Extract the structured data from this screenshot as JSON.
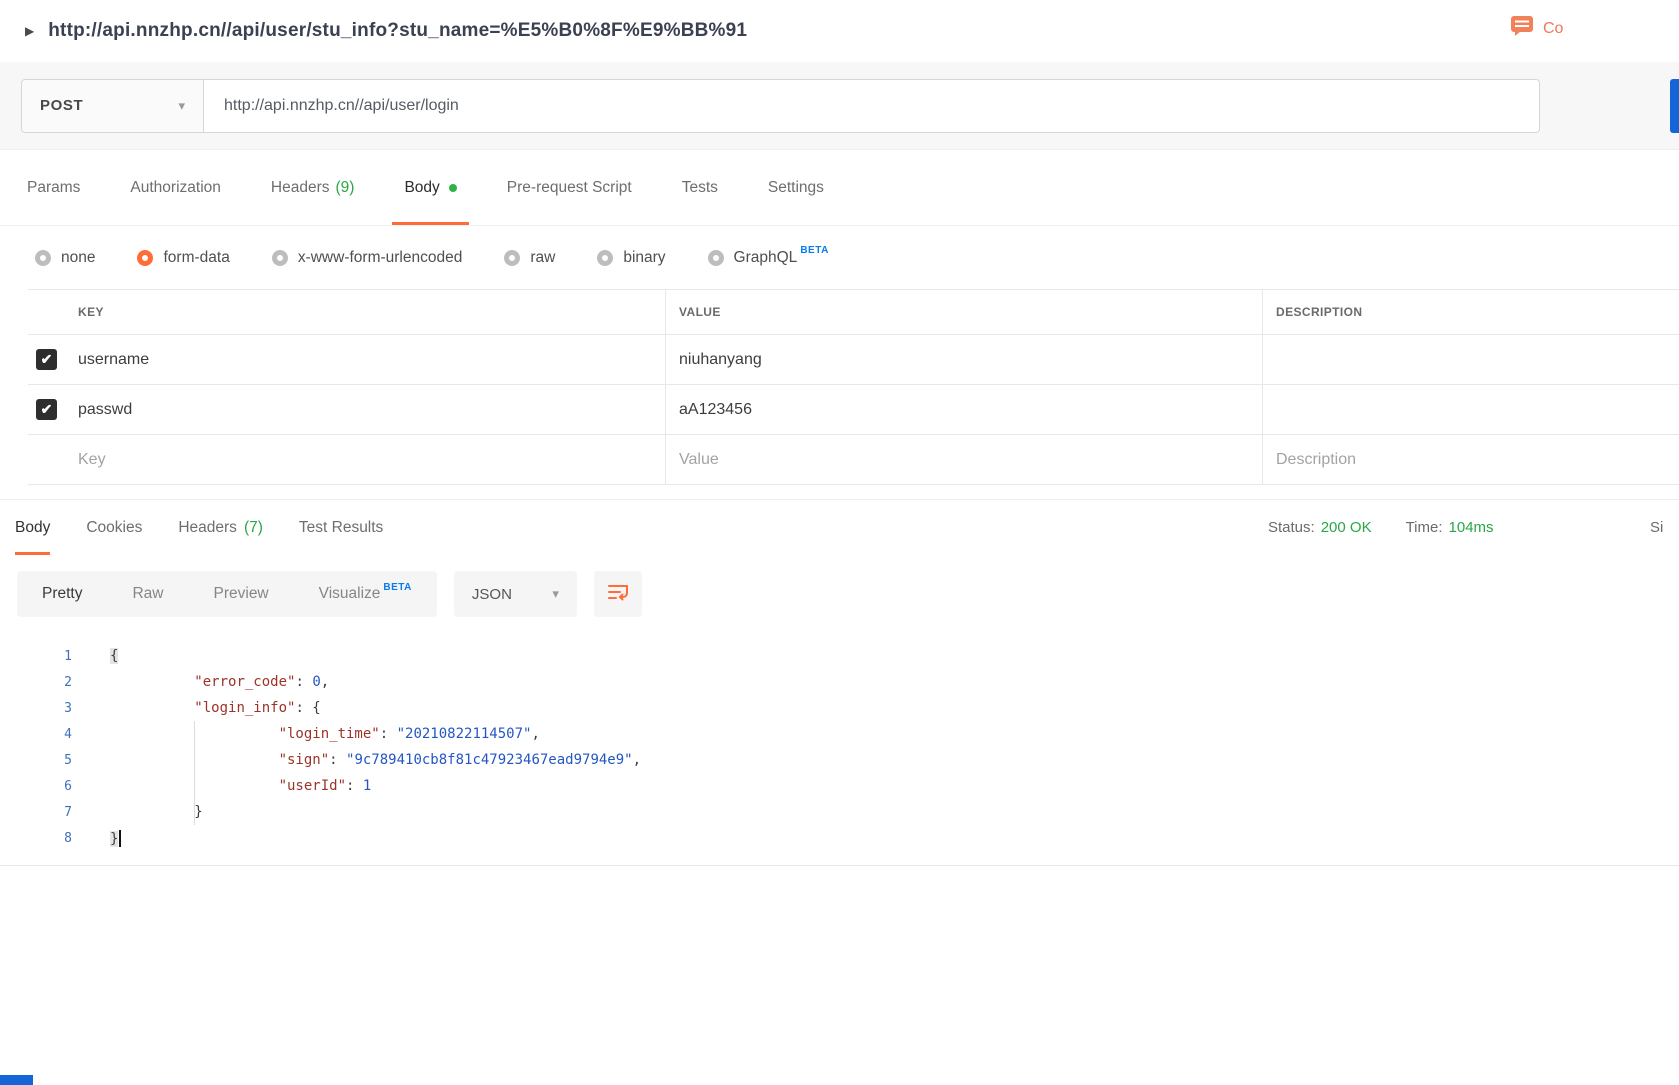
{
  "titlebar": {
    "request_url": "http://api.nnzhp.cn//api/user/stu_info?stu_name=%E5%B0%8F%E9%BB%91",
    "comments_label": "Co"
  },
  "request": {
    "method": "POST",
    "url": "http://api.nnzhp.cn//api/user/login"
  },
  "request_tabs": [
    {
      "label": "Params"
    },
    {
      "label": "Authorization"
    },
    {
      "label": "Headers",
      "count": "(9)"
    },
    {
      "label": "Body",
      "active": true,
      "dot": true
    },
    {
      "label": "Pre-request Script"
    },
    {
      "label": "Tests"
    },
    {
      "label": "Settings"
    }
  ],
  "body_types": [
    {
      "label": "none"
    },
    {
      "label": "form-data",
      "selected": true
    },
    {
      "label": "x-www-form-urlencoded"
    },
    {
      "label": "raw"
    },
    {
      "label": "binary"
    },
    {
      "label": "GraphQL",
      "badge": "BETA"
    }
  ],
  "kv_table": {
    "columns": [
      "KEY",
      "VALUE",
      "DESCRIPTION"
    ],
    "rows": [
      {
        "checked": true,
        "key": "username",
        "value": "niuhanyang",
        "description": ""
      },
      {
        "checked": true,
        "key": "passwd",
        "value": "aA123456",
        "description": ""
      }
    ],
    "placeholder": {
      "key": "Key",
      "value": "Value",
      "description": "Description"
    }
  },
  "response": {
    "tabs": [
      {
        "label": "Body",
        "active": true
      },
      {
        "label": "Cookies"
      },
      {
        "label": "Headers",
        "count": "(7)"
      },
      {
        "label": "Test Results"
      }
    ],
    "meta": {
      "status_label": "Status:",
      "status_value": "200 OK",
      "time_label": "Time:",
      "time_value": "104ms",
      "size_label_partial": "Si"
    },
    "view_tabs": [
      {
        "label": "Pretty",
        "active": true
      },
      {
        "label": "Raw"
      },
      {
        "label": "Preview"
      },
      {
        "label": "Visualize",
        "badge": "BETA"
      }
    ],
    "format_select": "JSON",
    "code_lines": [
      {
        "n": "1",
        "tokens": [
          {
            "t": "brace-hl",
            "s": "{"
          }
        ]
      },
      {
        "n": "2",
        "tokens": [
          {
            "t": "plain",
            "s": "          "
          },
          {
            "t": "key",
            "s": "\"error_code\""
          },
          {
            "t": "plain",
            "s": ": "
          },
          {
            "t": "num",
            "s": "0"
          },
          {
            "t": "plain",
            "s": ","
          }
        ]
      },
      {
        "n": "3",
        "tokens": [
          {
            "t": "plain",
            "s": "          "
          },
          {
            "t": "key",
            "s": "\"login_info\""
          },
          {
            "t": "plain",
            "s": ": {"
          }
        ]
      },
      {
        "n": "4",
        "tokens": [
          {
            "t": "plain",
            "s": "                    "
          },
          {
            "t": "key",
            "s": "\"login_time\""
          },
          {
            "t": "plain",
            "s": ": "
          },
          {
            "t": "str",
            "s": "\"20210822114507\""
          },
          {
            "t": "plain",
            "s": ","
          }
        ]
      },
      {
        "n": "5",
        "tokens": [
          {
            "t": "plain",
            "s": "                    "
          },
          {
            "t": "key",
            "s": "\"sign\""
          },
          {
            "t": "plain",
            "s": ": "
          },
          {
            "t": "str",
            "s": "\"9c789410cb8f81c47923467ead9794e9\""
          },
          {
            "t": "plain",
            "s": ","
          }
        ]
      },
      {
        "n": "6",
        "tokens": [
          {
            "t": "plain",
            "s": "                    "
          },
          {
            "t": "key",
            "s": "\"userId\""
          },
          {
            "t": "plain",
            "s": ": "
          },
          {
            "t": "num",
            "s": "1"
          }
        ]
      },
      {
        "n": "7",
        "tokens": [
          {
            "t": "plain",
            "s": "          "
          },
          {
            "t": "brace",
            "s": "}"
          }
        ]
      },
      {
        "n": "8",
        "tokens": [
          {
            "t": "brace-hl",
            "s": "}"
          },
          {
            "t": "cursor",
            "s": ""
          }
        ]
      }
    ]
  },
  "colors": {
    "accent_orange": "#ff6c37",
    "success_green": "#29a746",
    "beta_blue": "#097bed",
    "send_button_blue": "#1565d8",
    "json_key": "#9c3328",
    "json_value": "#2456c4",
    "line_number_blue": "#4170b8"
  }
}
